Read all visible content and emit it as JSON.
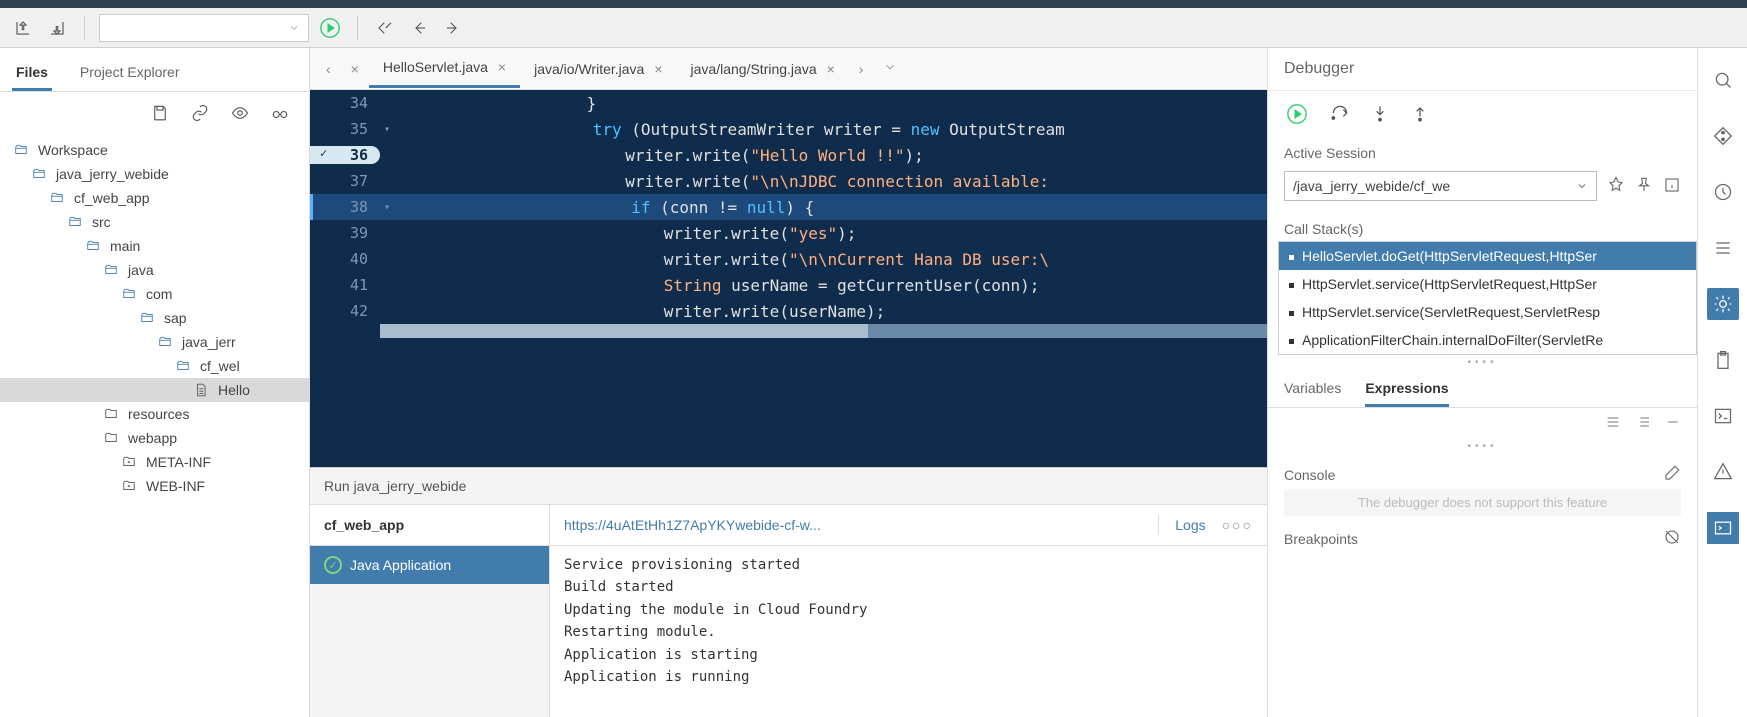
{
  "sidebar": {
    "tabs": [
      "Files",
      "Project Explorer"
    ],
    "activeTab": 0,
    "tree": [
      {
        "label": "Workspace",
        "indent": 0,
        "icon": "folder-open"
      },
      {
        "label": "java_jerry_webide",
        "indent": 1,
        "icon": "folder-open"
      },
      {
        "label": "cf_web_app",
        "indent": 2,
        "icon": "folder-open"
      },
      {
        "label": "src",
        "indent": 3,
        "icon": "folder-open"
      },
      {
        "label": "main",
        "indent": 4,
        "icon": "folder-open"
      },
      {
        "label": "java",
        "indent": 5,
        "icon": "folder-open"
      },
      {
        "label": "com",
        "indent": 6,
        "icon": "folder-open"
      },
      {
        "label": "sap",
        "indent": 7,
        "icon": "folder-open"
      },
      {
        "label": "java_jerr",
        "indent": 8,
        "icon": "folder-open"
      },
      {
        "label": "cf_wel",
        "indent": 9,
        "icon": "folder-open"
      },
      {
        "label": "Hello",
        "indent": 10,
        "icon": "file",
        "selected": true
      },
      {
        "label": "resources",
        "indent": 5,
        "icon": "folder"
      },
      {
        "label": "webapp",
        "indent": 5,
        "icon": "folder"
      },
      {
        "label": "META-INF",
        "indent": 6,
        "icon": "folder-plus"
      },
      {
        "label": "WEB-INF",
        "indent": 6,
        "icon": "folder-plus"
      }
    ]
  },
  "editor": {
    "tabs": [
      {
        "label": "HelloServlet.java",
        "active": true
      },
      {
        "label": "java/io/Writer.java",
        "active": false
      },
      {
        "label": "java/lang/String.java",
        "active": false
      }
    ],
    "lines": [
      {
        "n": 34,
        "fold": "",
        "indent": 20,
        "tokens": [
          {
            "t": "}",
            "c": ""
          }
        ]
      },
      {
        "n": 35,
        "fold": "-",
        "indent": 20,
        "tokens": [
          {
            "t": "try",
            "c": "kw"
          },
          {
            "t": " (OutputStreamWriter writer = ",
            "c": ""
          },
          {
            "t": "new",
            "c": "kw"
          },
          {
            "t": " OutputStream",
            "c": ""
          }
        ]
      },
      {
        "n": 36,
        "fold": "",
        "bp": true,
        "indent": 24,
        "tokens": [
          {
            "t": "writer.write(",
            "c": ""
          },
          {
            "t": "\"Hello World !!\"",
            "c": "str"
          },
          {
            "t": ");",
            "c": ""
          }
        ]
      },
      {
        "n": 37,
        "fold": "",
        "indent": 24,
        "tokens": [
          {
            "t": "writer.write(",
            "c": ""
          },
          {
            "t": "\"\\n\\nJDBC connection available:",
            "c": "str"
          }
        ]
      },
      {
        "n": 38,
        "fold": "-",
        "hl": true,
        "indent": 24,
        "tokens": [
          {
            "t": "if",
            "c": "kw"
          },
          {
            "t": " (conn != ",
            "c": ""
          },
          {
            "t": "null",
            "c": "kw"
          },
          {
            "t": ") {",
            "c": ""
          }
        ]
      },
      {
        "n": 39,
        "fold": "",
        "indent": 28,
        "tokens": [
          {
            "t": "writer.write(",
            "c": ""
          },
          {
            "t": "\"yes\"",
            "c": "str"
          },
          {
            "t": ");",
            "c": ""
          }
        ]
      },
      {
        "n": 40,
        "fold": "",
        "indent": 28,
        "tokens": [
          {
            "t": "writer.write(",
            "c": ""
          },
          {
            "t": "\"\\n\\nCurrent Hana DB user:\\",
            "c": "str"
          }
        ]
      },
      {
        "n": 41,
        "fold": "",
        "indent": 28,
        "tokens": [
          {
            "t": "String",
            "c": "type"
          },
          {
            "t": " userName = getCurrentUser(conn);",
            "c": ""
          }
        ]
      },
      {
        "n": 42,
        "fold": "",
        "indent": 28,
        "tokens": [
          {
            "t": "writer.write(userName);",
            "c": ""
          }
        ]
      }
    ]
  },
  "run": {
    "title": "Run java_jerry_webide",
    "app": "cf_web_app",
    "item": "Java Application",
    "url": "https://4uAtEtHh1Z7ApYKYwebide-cf-w...",
    "logsLabel": "Logs",
    "console": [
      "Service provisioning started",
      "Build started",
      "Updating the module in Cloud Foundry",
      "Restarting module.",
      "Application is starting",
      "Application is running"
    ]
  },
  "debugger": {
    "title": "Debugger",
    "activeSessionLabel": "Active Session",
    "session": "/java_jerry_webide/cf_we",
    "callStackLabel": "Call Stack(s)",
    "stack": [
      "HelloServlet.doGet(HttpServletRequest,HttpSer",
      "HttpServlet.service(HttpServletRequest,HttpSer",
      "HttpServlet.service(ServletRequest,ServletResp",
      "ApplicationFilterChain.internalDoFilter(ServletRe"
    ],
    "tabs": [
      "Variables",
      "Expressions"
    ],
    "activeTab": 1,
    "consoleLabel": "Console",
    "consoleMsg": "The debugger does not support this feature",
    "breakpointsLabel": "Breakpoints"
  }
}
